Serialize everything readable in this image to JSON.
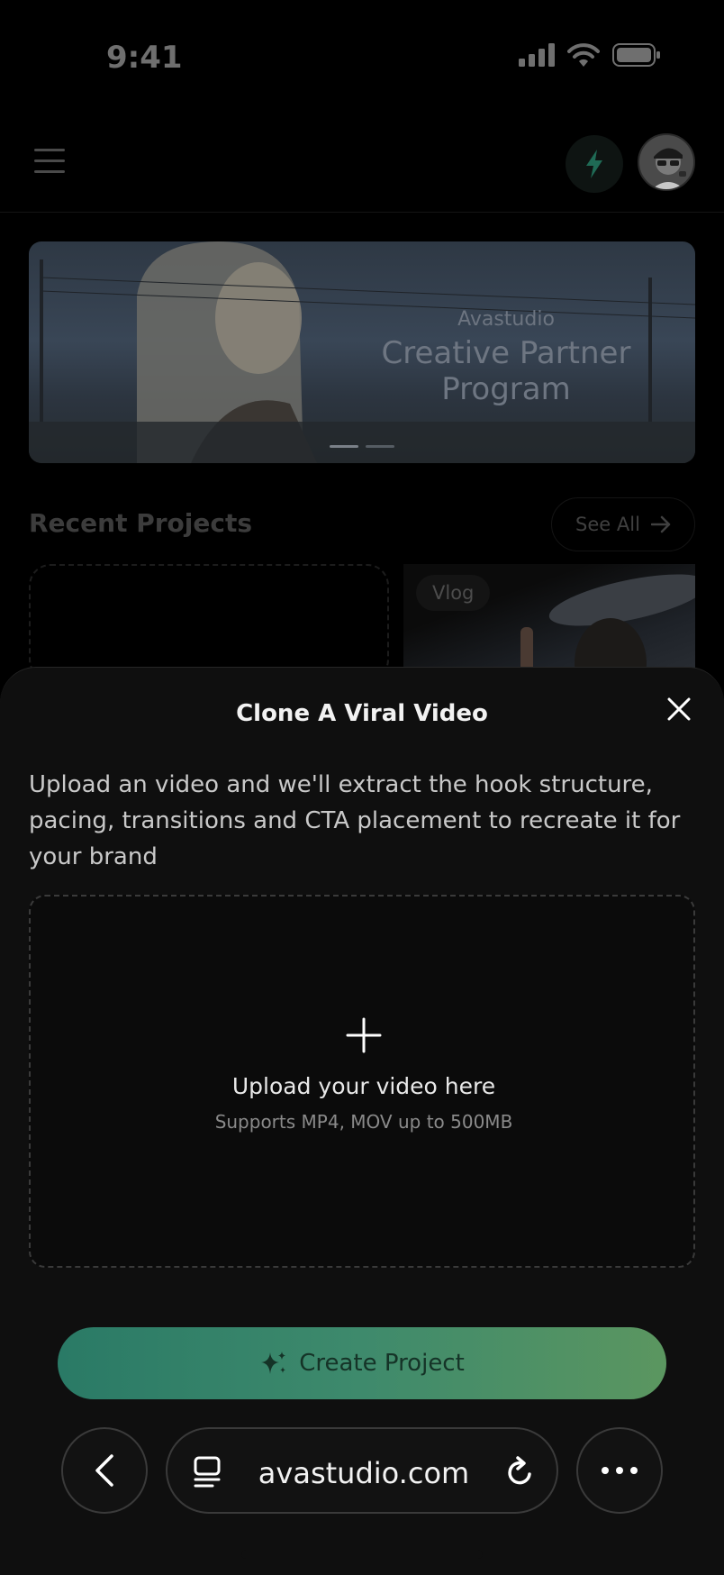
{
  "status_bar": {
    "time": "9:41"
  },
  "top_nav": {
    "menu_icon": "hamburger-icon",
    "credits_icon": "bolt-icon",
    "accent": "#2fb48a"
  },
  "banner": {
    "brand": "Avastudio",
    "title_line1": "Creative Partner",
    "title_line2": "Program"
  },
  "recent_projects": {
    "title": "Recent Projects",
    "see_all": "See All",
    "items": [
      {
        "chip": "Vlog"
      }
    ]
  },
  "sheet": {
    "title": "Clone A Viral Video",
    "description": "Upload an video and we'll extract the hook structure, pacing, transitions and CTA placement to recreate it for your brand",
    "upload": {
      "title": "Upload your video here",
      "subtitle": "Supports MP4, MOV up to 500MB"
    },
    "cta": "Create Project"
  },
  "browser": {
    "url": "avastudio.com"
  }
}
